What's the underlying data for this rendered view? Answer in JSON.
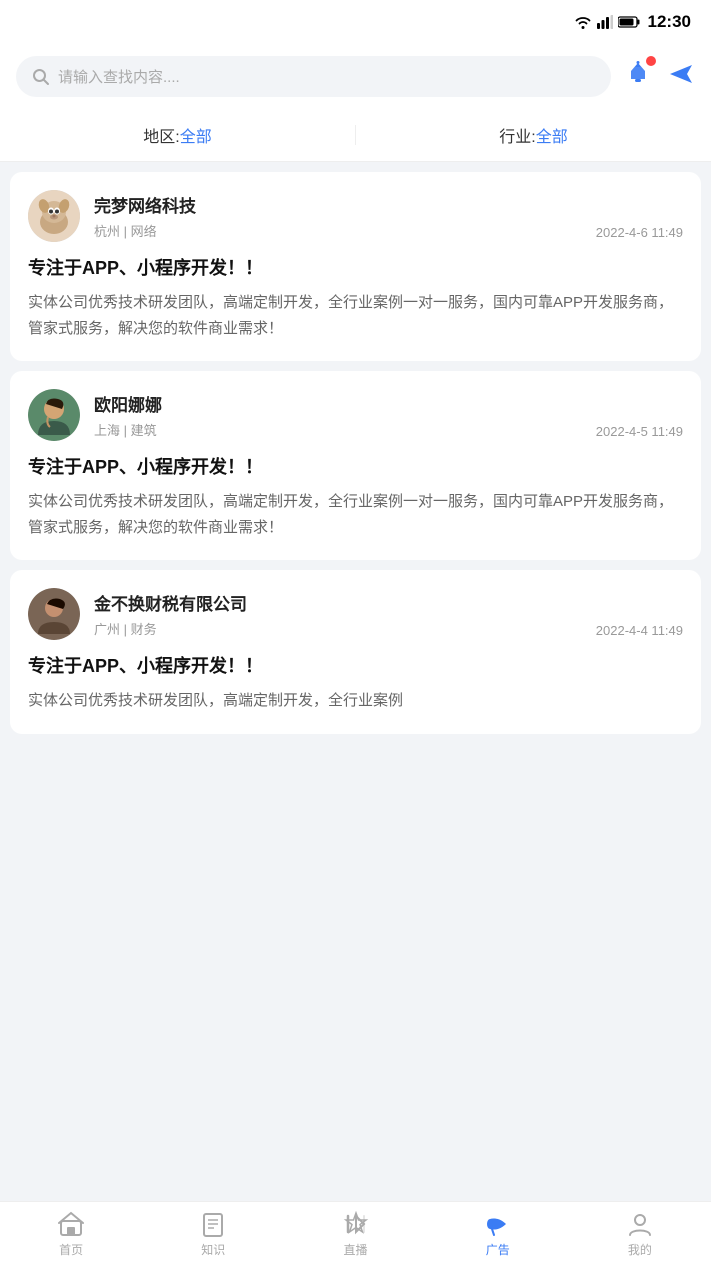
{
  "statusBar": {
    "time": "12:30"
  },
  "searchBar": {
    "placeholder": "请输入查找内容...."
  },
  "filter": {
    "regionLabel": "地区:",
    "regionValue": "全部",
    "industryLabel": "行业:",
    "industryValue": "全部"
  },
  "cards": [
    {
      "id": 1,
      "companyName": "完梦网络科技",
      "subInfo": "杭州  |  网络",
      "date": "2022-4-6 11:49",
      "title": "专注于APP、小程序开发！！",
      "body": "实体公司优秀技术研发团队，高端定制开发，全行业案例一对一服务，国内可靠APP开发服务商，管家式服务，解决您的软件商业需求！",
      "avatarColor": "#6baed6",
      "avatarType": "dog"
    },
    {
      "id": 2,
      "companyName": "欧阳娜娜",
      "subInfo": "上海  |  建筑",
      "date": "2022-4-5 11:49",
      "title": "专注于APP、小程序开发！！",
      "body": "实体公司优秀技术研发团队，高端定制开发，全行业案例一对一服务，国内可靠APP开发服务商，管家式服务，解决您的软件商业需求！",
      "avatarColor": "#74a57f",
      "avatarType": "person"
    },
    {
      "id": 3,
      "companyName": "金不换财税有限公司",
      "subInfo": "广州  |  财务",
      "date": "2022-4-4 11:49",
      "title": "专注于APP、小程序开发！！",
      "body": "实体公司优秀技术研发团队，高端定制开发，全行业案例",
      "avatarColor": "#8b7355",
      "avatarType": "person2"
    }
  ],
  "bottomNav": [
    {
      "id": "home",
      "label": "首页",
      "active": false
    },
    {
      "id": "knowledge",
      "label": "知识",
      "active": false
    },
    {
      "id": "live",
      "label": "直播",
      "active": false
    },
    {
      "id": "ad",
      "label": "广告",
      "active": true
    },
    {
      "id": "me",
      "label": "我的",
      "active": false
    }
  ]
}
